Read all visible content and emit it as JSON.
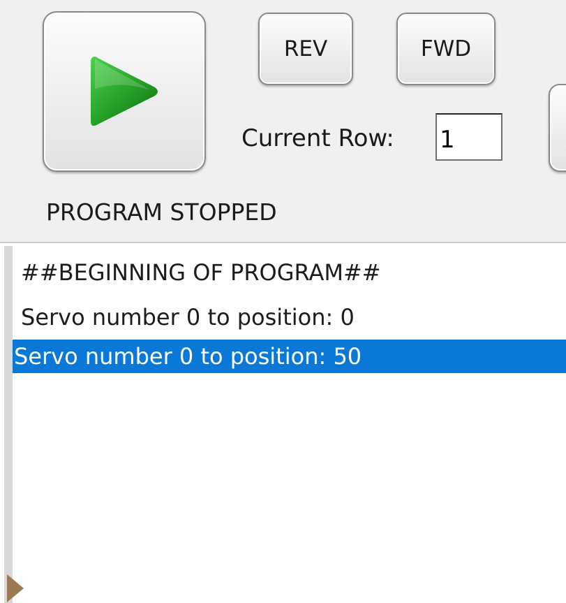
{
  "toolbar": {
    "play_icon": "play-icon",
    "play_color": "#2fa82f",
    "rev_label": "REV",
    "fwd_label": "FWD",
    "current_row_label": "Current Row:",
    "current_row_value": "1",
    "status": "PROGRAM STOPPED"
  },
  "program": {
    "items": [
      "##BEGINNING OF PROGRAM##",
      "Servo number 0 to position: 0",
      "Servo number 0 to position: 50"
    ],
    "selected_color": "#0a78d7"
  }
}
